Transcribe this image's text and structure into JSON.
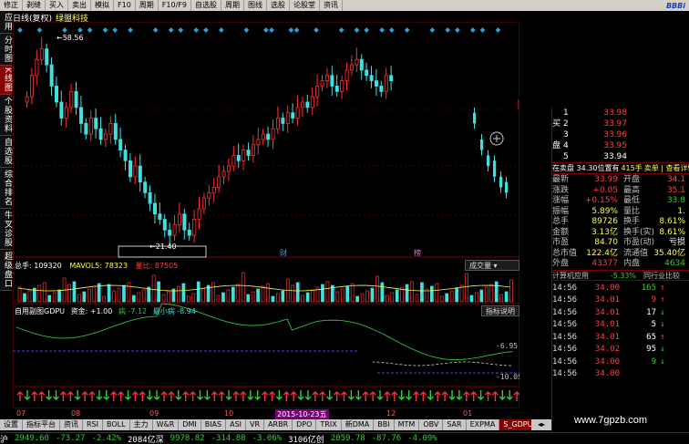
{
  "menu": [
    "修正",
    "剥缝",
    "买入",
    "卖出",
    "模拟",
    "F10",
    "周期",
    "F10/F9",
    "自选股",
    "周期",
    "图线",
    "选股",
    "论股堂",
    "资讯"
  ],
  "menu_logo": "BBBi",
  "left_tabs": [
    {
      "label": "应用",
      "active": false
    },
    {
      "label": "分时图",
      "active": false
    },
    {
      "label": "K线图",
      "active": true
    },
    {
      "label": "个股资料",
      "active": false
    },
    {
      "label": "自选股",
      "active": false
    },
    {
      "label": "综合排名",
      "active": false
    },
    {
      "label": "牛叉诊股",
      "active": false
    },
    {
      "label": "超级盘口",
      "active": false
    }
  ],
  "chart_title": {
    "period": "日线(复权)",
    "name": "绿盟科技"
  },
  "main_axis_labels": [
    "45.30",
    "44.13",
    "35.94",
    "27.64"
  ],
  "price_annotations": {
    "high": "58.56",
    "low": "21.40"
  },
  "markers": [
    "财",
    "榜"
  ],
  "volume": {
    "title": "总手: 109320",
    "mavol": "MAVOL5: 78323",
    "ratio": "量比: 87505",
    "button": "成交量",
    "axis_labels": [
      "23766",
      "12126",
      "X10"
    ]
  },
  "indicator": {
    "title": "自用副图GDPU",
    "hold": "资金: +1.00",
    "sick": "病 -7.12",
    "min_sick": "最小病 -8.94",
    "button": "指标说明",
    "axis_labels": [
      "-6.95",
      "-10.05"
    ]
  },
  "date_axis": [
    "07",
    "08",
    "09",
    "10",
    "2015-10-23五",
    "12",
    "01"
  ],
  "bottom_tabs": [
    {
      "label": "设置",
      "sel": false
    },
    {
      "label": "指标平台",
      "sel": false
    },
    {
      "label": "资讯",
      "sel": false
    },
    {
      "label": "RSI",
      "sel": false
    },
    {
      "label": "BOLL",
      "sel": false
    },
    {
      "label": "主力",
      "sel": false
    },
    {
      "label": "W&R",
      "sel": false
    },
    {
      "label": "DMI",
      "sel": false
    },
    {
      "label": "BIAS",
      "sel": false
    },
    {
      "label": "ASI",
      "sel": false
    },
    {
      "label": "VR",
      "sel": false
    },
    {
      "label": "ARBR",
      "sel": false
    },
    {
      "label": "DPO",
      "sel": false
    },
    {
      "label": "TRIX",
      "sel": false
    },
    {
      "label": "新DMA",
      "sel": false
    },
    {
      "label": "BBI",
      "sel": false
    },
    {
      "label": "MTM",
      "sel": false
    },
    {
      "label": "OBV",
      "sel": false
    },
    {
      "label": "SAR",
      "sel": false
    },
    {
      "label": "EXPMA",
      "sel": false
    },
    {
      "label": "S_GDPU",
      "sel": true
    }
  ],
  "status": [
    {
      "text": "沪",
      "c": "white"
    },
    {
      "text": "2949.60",
      "c": "green"
    },
    {
      "text": "-73.27",
      "c": "green"
    },
    {
      "text": "-2.42%",
      "c": "green"
    },
    {
      "text": "2084亿深",
      "c": "white"
    },
    {
      "text": "9978.82",
      "c": "green"
    },
    {
      "text": "-314.88",
      "c": "green"
    },
    {
      "text": "-3.06%",
      "c": "green"
    },
    {
      "text": "3106亿创",
      "c": "white"
    },
    {
      "text": "2059.78",
      "c": "green"
    },
    {
      "text": "-87.76",
      "c": "green"
    },
    {
      "text": "-4.09%",
      "c": "green"
    }
  ],
  "order_book": {
    "sell_label": "买",
    "buy_label": "盘",
    "rows": [
      {
        "n": "1",
        "p": "33.98",
        "v": "",
        "c": "red"
      },
      {
        "n": "2",
        "p": "33.97",
        "v": "",
        "c": "red"
      },
      {
        "n": "3",
        "p": "33.96",
        "v": "",
        "c": "red"
      },
      {
        "n": "4",
        "p": "33.95",
        "v": "",
        "c": "red"
      },
      {
        "n": "5",
        "p": "33.94",
        "v": "",
        "c": "white"
      }
    ],
    "summary": "在卖盘 34.30位置有",
    "summary_num": "415手",
    "summary_tag": "卖单 | 查看详情"
  },
  "quote": [
    {
      "k": "最新",
      "v": "33.99",
      "vc": "red",
      "k2": "开盘",
      "v2": "34.1",
      "v2c": "red"
    },
    {
      "k": "涨跌",
      "v": "+0.05",
      "vc": "red",
      "k2": "最高",
      "v2": "35.1",
      "v2c": "red"
    },
    {
      "k": "涨幅",
      "v": "+0.15%",
      "vc": "red",
      "k2": "最低",
      "v2": "33.8",
      "v2c": "green"
    },
    {
      "k": "振幅",
      "v": "5.89%",
      "vc": "yel",
      "k2": "量比",
      "v2": "1.",
      "v2c": "yel"
    },
    {
      "k": "总手",
      "v": "89726",
      "vc": "yel",
      "k2": "换手",
      "v2": "8.61%",
      "v2c": "yel"
    },
    {
      "k": "金额",
      "v": "3.13亿",
      "vc": "yel",
      "k2": "换手(实)",
      "v2": "8.61%",
      "v2c": "yel"
    },
    {
      "k": "市盈",
      "v": "84.70",
      "vc": "yel",
      "k2": "市盈(动)",
      "v2": "亏损",
      "v2c": "white"
    },
    {
      "k": "总市值",
      "v": "122.4亿",
      "vc": "yel",
      "k2": "流通值",
      "v2": "35.40亿",
      "v2c": "yel"
    },
    {
      "k": "外盘",
      "v": "43377",
      "vc": "red",
      "k2": "内盘",
      "v2": "4634",
      "v2c": "green"
    }
  ],
  "sector": {
    "label": "计算机应用",
    "pct": "-5.33%",
    "link": "同行业比较"
  },
  "ticks": [
    {
      "t": "14:56",
      "p": "34.00",
      "v": "165",
      "pc": "red",
      "vc": "green",
      "a": "↑"
    },
    {
      "t": "14:56",
      "p": "34.01",
      "v": "9",
      "pc": "red",
      "vc": "red",
      "a": "↑"
    },
    {
      "t": "14:56",
      "p": "34.01",
      "v": "17",
      "pc": "red",
      "vc": "white",
      "a": "↓"
    },
    {
      "t": "14:56",
      "p": "34.01",
      "v": "5",
      "pc": "red",
      "vc": "white",
      "a": "↓"
    },
    {
      "t": "14:56",
      "p": "34.01",
      "v": "65",
      "pc": "red",
      "vc": "white",
      "a": "↑"
    },
    {
      "t": "14:56",
      "p": "34.02",
      "v": "95",
      "pc": "red",
      "vc": "white",
      "a": "↓"
    },
    {
      "t": "14:56",
      "p": "34.00",
      "v": "9",
      "pc": "red",
      "vc": "green",
      "a": "↓"
    },
    {
      "t": "14:56",
      "p": "34.00",
      "v": "",
      "pc": "red",
      "vc": "green",
      "a": ""
    }
  ],
  "watermark": "www.7gpzb.com"
}
